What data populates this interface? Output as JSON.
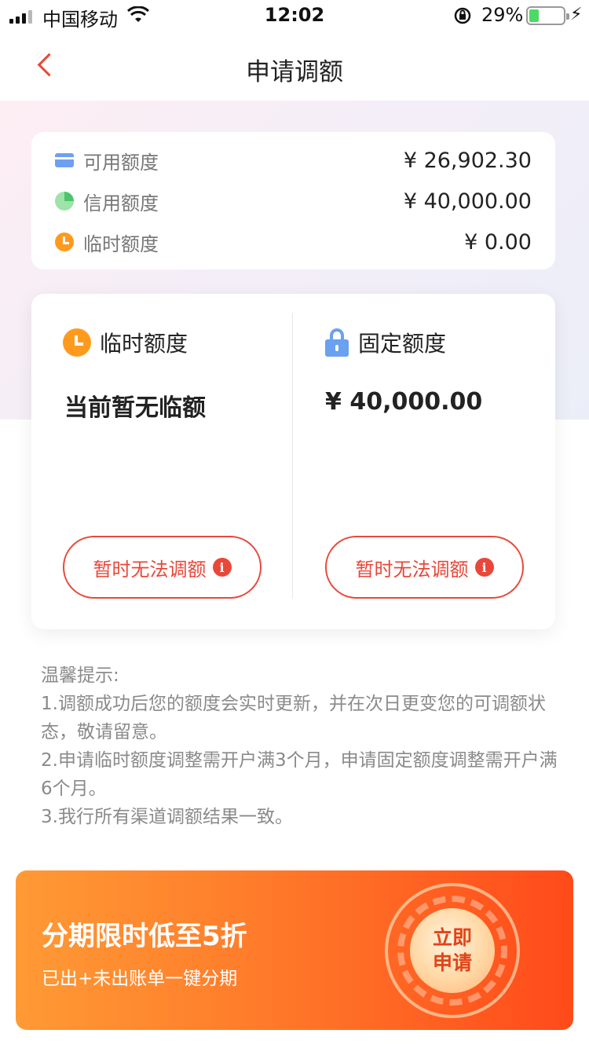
{
  "status_bar": {
    "carrier": "中国移动",
    "time": "12:02",
    "battery_percent": "29%",
    "battery_level": 0.29
  },
  "nav": {
    "title": "申请调额"
  },
  "summary": {
    "items": [
      {
        "label": "可用额度",
        "value": "¥ 26,902.30",
        "icon": "card-icon"
      },
      {
        "label": "信用额度",
        "value": "¥ 40,000.00",
        "icon": "pie-icon"
      },
      {
        "label": "临时额度",
        "value": "¥ 0.00",
        "icon": "clock-icon"
      }
    ]
  },
  "quota": {
    "temporary": {
      "title": "临时额度",
      "value": "当前暂无临额",
      "button": "暂时无法调额"
    },
    "fixed": {
      "title": "固定额度",
      "value": "¥ 40,000.00",
      "button": "暂时无法调额"
    }
  },
  "tips": {
    "heading": "温馨提示:",
    "lines": [
      "1.调额成功后您的额度会实时更新，并在次日更变您的可调额状态，敬请留意。",
      "2.申请临时额度调整需开户满3个月，申请固定额度调整需开户满6个月。",
      "3.我行所有渠道调额结果一致。"
    ]
  },
  "banner": {
    "title": "分期限时低至5折",
    "subtitle": "已出+未出账单一键分期",
    "cta": "立即申请"
  },
  "colors": {
    "accent": "#e8483a",
    "clock": "#ff9a1e",
    "lock": "#6aa1f0",
    "banner_start": "#ff9a35",
    "banner_end": "#ff4a1a"
  }
}
